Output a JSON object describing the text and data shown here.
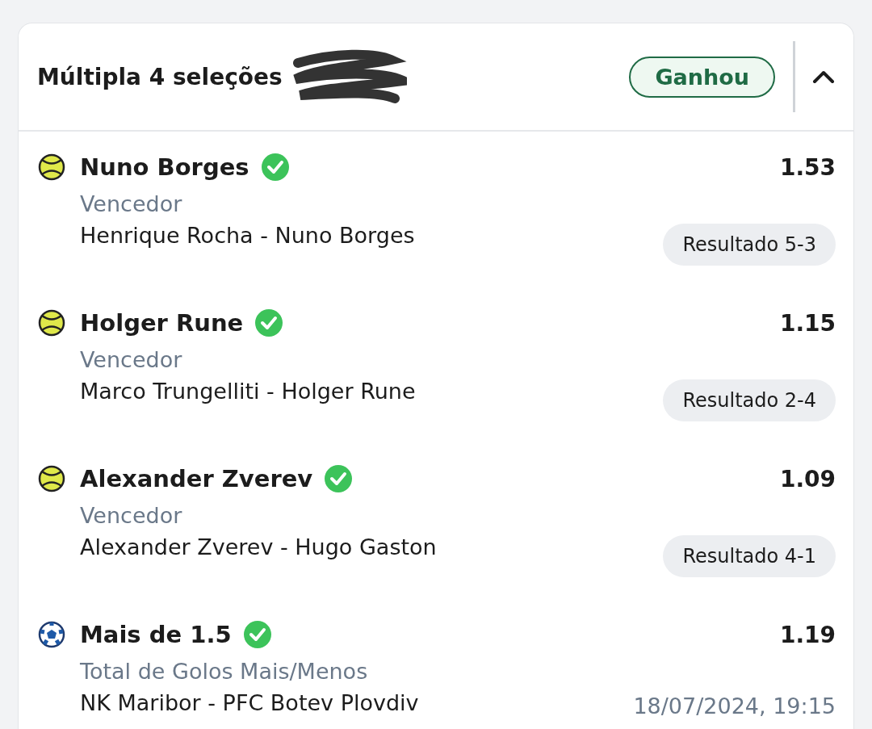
{
  "bet": {
    "title": "Múltipla 4 seleções",
    "redacted": true,
    "status": "Ganhou",
    "expanded": true
  },
  "selections": [
    {
      "kind": "tennis",
      "name": "Nuno Borges",
      "won": true,
      "odds": "1.53",
      "market": "Vencedor",
      "event": "Henrique Rocha - Nuno Borges",
      "result": "Resultado 5-3"
    },
    {
      "kind": "tennis",
      "name": "Holger Rune",
      "won": true,
      "odds": "1.15",
      "market": "Vencedor",
      "event": "Marco Trungelliti - Holger Rune",
      "result": "Resultado 2-4"
    },
    {
      "kind": "tennis",
      "name": "Alexander Zverev",
      "won": true,
      "odds": "1.09",
      "market": "Vencedor",
      "event": "Alexander Zverev - Hugo Gaston",
      "result": "Resultado 4-1"
    },
    {
      "kind": "football",
      "name": "Mais de 1.5",
      "won": true,
      "odds": "1.19",
      "market": "Total de Golos Mais/Menos",
      "event": "NK Maribor - PFC Botev Plovdiv",
      "date": "18/07/2024, 19:15"
    }
  ]
}
